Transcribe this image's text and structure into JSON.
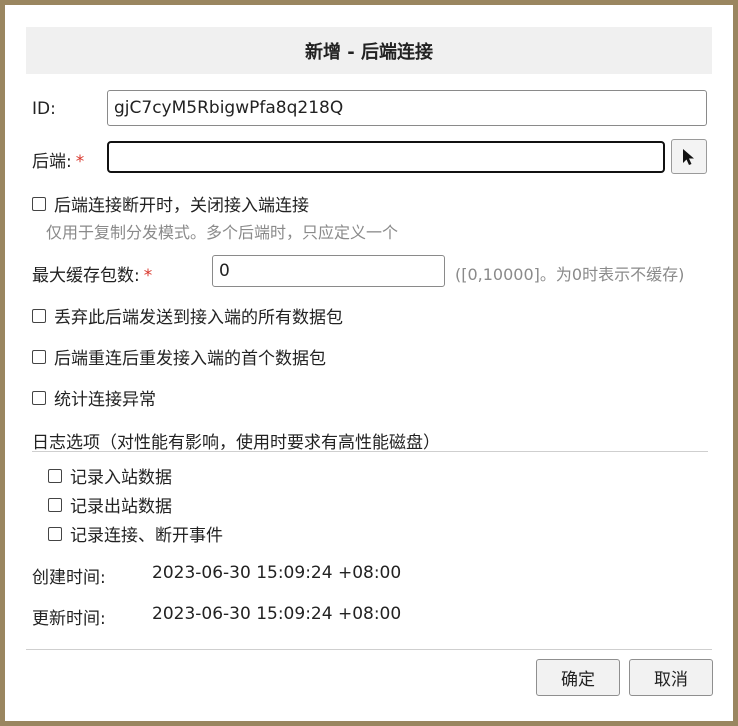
{
  "dialog": {
    "title": "新增 - 后端连接"
  },
  "form": {
    "id_label": "ID:",
    "id_value": "gjC7cyM5RbigwPfa8q218Q",
    "backend_label": "后端:",
    "backend_required": "*",
    "backend_value": "",
    "close_on_backend_disconnect": {
      "label": "后端连接断开时，关闭接入端连接",
      "checked": false,
      "hint": "仅用于复制分发模式。多个后端时，只应定义一个"
    },
    "max_cache_label": "最大缓存包数:",
    "max_cache_required": "*",
    "max_cache_value": "0",
    "max_cache_hint": "([0,10000]。为0时表示不缓存)",
    "drop_backend_packets": {
      "label": "丢弃此后端发送到接入端的所有数据包",
      "checked": false
    },
    "resend_first_packet": {
      "label": "后端重连后重发接入端的首个数据包",
      "checked": false
    },
    "stat_exceptions": {
      "label": "统计连接异常",
      "checked": false
    },
    "log_section_title": "日志选项（对性能有影响，使用时要求有高性能磁盘）",
    "log_inbound": {
      "label": "记录入站数据",
      "checked": false
    },
    "log_outbound": {
      "label": "记录出站数据",
      "checked": false
    },
    "log_events": {
      "label": "记录连接、断开事件",
      "checked": false
    },
    "created_label": "创建时间:",
    "created_value": "2023-06-30 15:09:24 +08:00",
    "updated_label": "更新时间:",
    "updated_value": "2023-06-30 15:09:24 +08:00"
  },
  "footer": {
    "ok_label": "确定",
    "cancel_label": "取消"
  },
  "icons": {
    "picker": "cursor-arrow-icon"
  }
}
